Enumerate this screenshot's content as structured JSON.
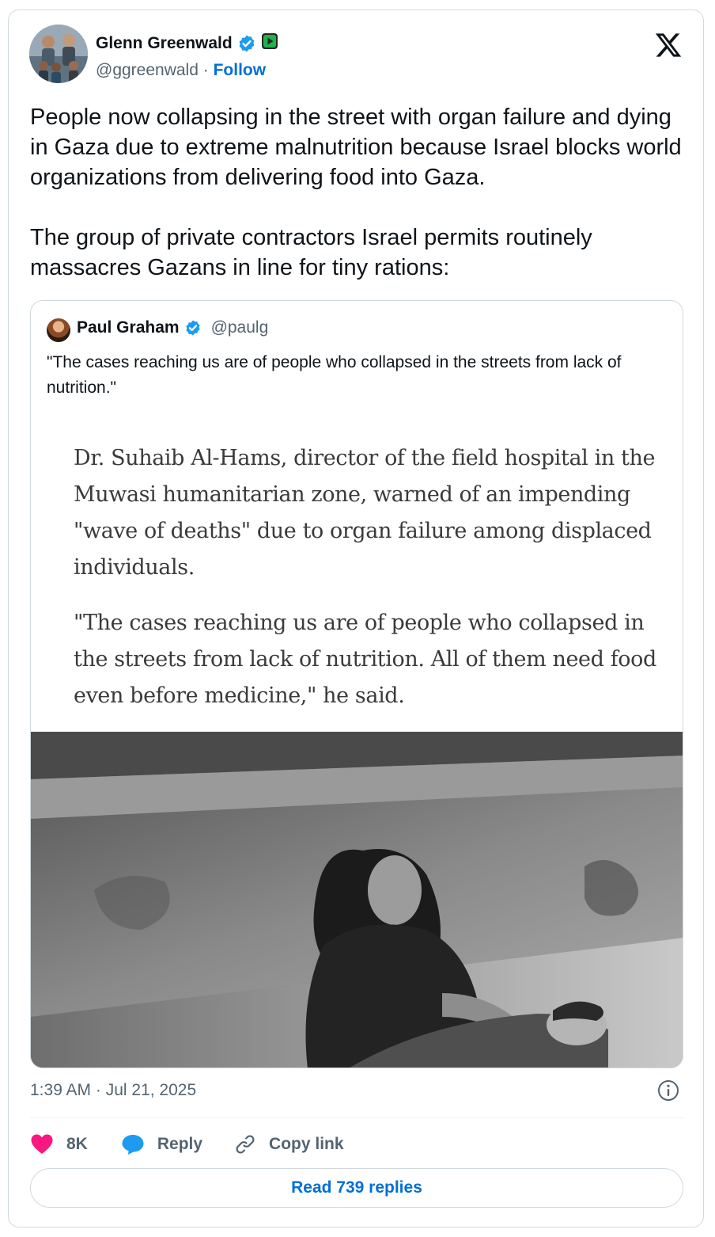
{
  "tweet": {
    "author": {
      "name": "Glenn Greenwald",
      "handle": "@ggreenwald",
      "separator": "·",
      "follow_label": "Follow"
    },
    "text": "People now collapsing in the street with organ failure and dying in Gaza due to extreme malnutrition because Israel blocks world organizations from delivering food into Gaza.\n\nThe group of private contractors Israel permits routinely massacres Gazans in line for tiny rations:",
    "timestamp": "1:39 AM · Jul 21, 2025"
  },
  "quote": {
    "author": {
      "name": "Paul Graham",
      "handle": "@paulg"
    },
    "text": "\"The cases reaching us are of people who collapsed in the streets from lack of nutrition.\"",
    "article_paragraphs": [
      "Dr. Suhaib Al-Hams, director of the field hospital in the Muwasi humanitarian zone, warned of an impending \"wave of deaths\" due to organ failure among displaced individuals.",
      "\"The cases reaching us are of people who collapsed in the streets from lack of nutrition. All of them need food even before medicine,\" he said."
    ]
  },
  "actions": {
    "like_count": "8K",
    "reply_label": "Reply",
    "copy_link_label": "Copy link",
    "read_replies_label": "Read 739 replies"
  },
  "colors": {
    "verified": "#1d9bf0",
    "like": "#f91880",
    "reply": "#1d9bf0",
    "link": "#006fd6",
    "secondary_text": "#536471",
    "border": "#cfd9de",
    "badge": "#22b14c"
  },
  "icons": {
    "platform_logo": "x-logo-icon",
    "verified": "verified-badge-icon",
    "rumble": "rumble-badge-icon",
    "info": "info-icon",
    "like": "heart-icon",
    "reply": "reply-bubble-icon",
    "copy_link": "link-icon"
  }
}
